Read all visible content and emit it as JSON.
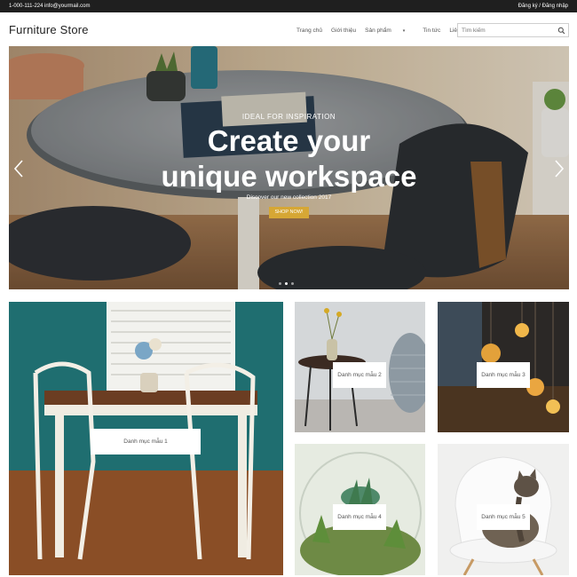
{
  "topbar": {
    "phone": "1-000-111-224",
    "email": "info@yourmail.com",
    "auth": "Đăng ký / Đăng nhập"
  },
  "header": {
    "logo": "Furniture Store",
    "nav": [
      {
        "label": "Trang chủ"
      },
      {
        "label": "Giới thiệu"
      },
      {
        "label": "Sản phẩm",
        "has_dropdown": true
      },
      {
        "label": "Tin tức"
      },
      {
        "label": "Liên hệ"
      }
    ],
    "search_placeholder": "Tìm kiếm",
    "search_icon": "search-icon"
  },
  "hero": {
    "kicker": "IDEAL FOR INSPIRATION",
    "title_line1": "Create your",
    "title_line2": "unique workspace",
    "subtitle": "Discover our new collection 2017",
    "button": "SHOP NOW!",
    "arrow_left_icon": "chevron-left-icon",
    "arrow_right_icon": "chevron-right-icon",
    "slides_count": 3,
    "active_slide": 2,
    "accent_color": "#d6a735"
  },
  "categories": [
    {
      "label": "Danh mục mẫu 1"
    },
    {
      "label": "Danh mục mẫu 2"
    },
    {
      "label": "Danh mục mẫu 3"
    },
    {
      "label": "Danh mục mẫu 4"
    },
    {
      "label": "Danh mục mẫu 5"
    }
  ]
}
